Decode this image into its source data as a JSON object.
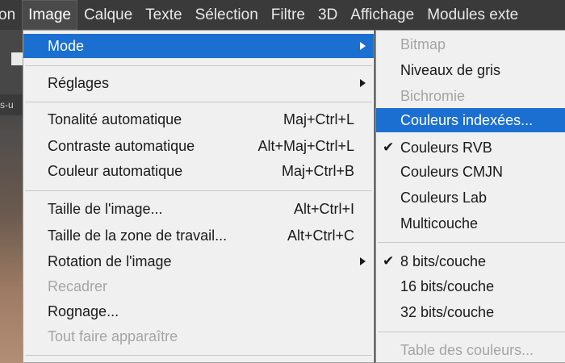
{
  "menubar": {
    "items": [
      "on",
      "Image",
      "Calque",
      "Texte",
      "Sélection",
      "Filtre",
      "3D",
      "Affichage",
      "Modules exte"
    ]
  },
  "background": {
    "tab_fragment": "s-u"
  },
  "image_menu": {
    "items": [
      {
        "label": "Mode",
        "shortcut": "",
        "submenu": true,
        "state": "highlighted"
      },
      {
        "label": "Réglages",
        "shortcut": "",
        "submenu": true,
        "state": "normal"
      },
      {
        "label": "Tonalité automatique",
        "shortcut": "Maj+Ctrl+L",
        "submenu": false,
        "state": "normal"
      },
      {
        "label": "Contraste automatique",
        "shortcut": "Alt+Maj+Ctrl+L",
        "submenu": false,
        "state": "normal"
      },
      {
        "label": "Couleur automatique",
        "shortcut": "Maj+Ctrl+B",
        "submenu": false,
        "state": "normal"
      },
      {
        "label": "Taille de l'image...",
        "shortcut": "Alt+Ctrl+I",
        "submenu": false,
        "state": "normal"
      },
      {
        "label": "Taille de la zone de travail...",
        "shortcut": "Alt+Ctrl+C",
        "submenu": false,
        "state": "normal"
      },
      {
        "label": "Rotation de l'image",
        "shortcut": "",
        "submenu": true,
        "state": "normal"
      },
      {
        "label": "Recadrer",
        "shortcut": "",
        "submenu": false,
        "state": "disabled"
      },
      {
        "label": "Rognage...",
        "shortcut": "",
        "submenu": false,
        "state": "normal"
      },
      {
        "label": "Tout faire apparaître",
        "shortcut": "",
        "submenu": false,
        "state": "disabled"
      }
    ]
  },
  "mode_submenu": {
    "items": [
      {
        "label": "Bitmap",
        "checked": false,
        "state": "disabled"
      },
      {
        "label": "Niveaux de gris",
        "checked": false,
        "state": "normal"
      },
      {
        "label": "Bichromie",
        "checked": false,
        "state": "disabled"
      },
      {
        "label": "Couleurs indexées...",
        "checked": false,
        "state": "highlighted"
      },
      {
        "label": "Couleurs RVB",
        "checked": true,
        "state": "normal"
      },
      {
        "label": "Couleurs CMJN",
        "checked": false,
        "state": "normal"
      },
      {
        "label": "Couleurs Lab",
        "checked": false,
        "state": "normal"
      },
      {
        "label": "Multicouche",
        "checked": false,
        "state": "normal"
      },
      {
        "label": "8 bits/couche",
        "checked": true,
        "state": "normal"
      },
      {
        "label": "16 bits/couche",
        "checked": false,
        "state": "normal"
      },
      {
        "label": "32 bits/couche",
        "checked": false,
        "state": "normal"
      },
      {
        "label": "Table des couleurs...",
        "checked": false,
        "state": "disabled"
      }
    ],
    "check_glyph": "✔"
  },
  "colors": {
    "highlight": "#1b6fd0",
    "menu_bg": "#f0f0f0",
    "menubar_bg": "#3a3a3a",
    "disabled_text": "#a5a5a5"
  }
}
